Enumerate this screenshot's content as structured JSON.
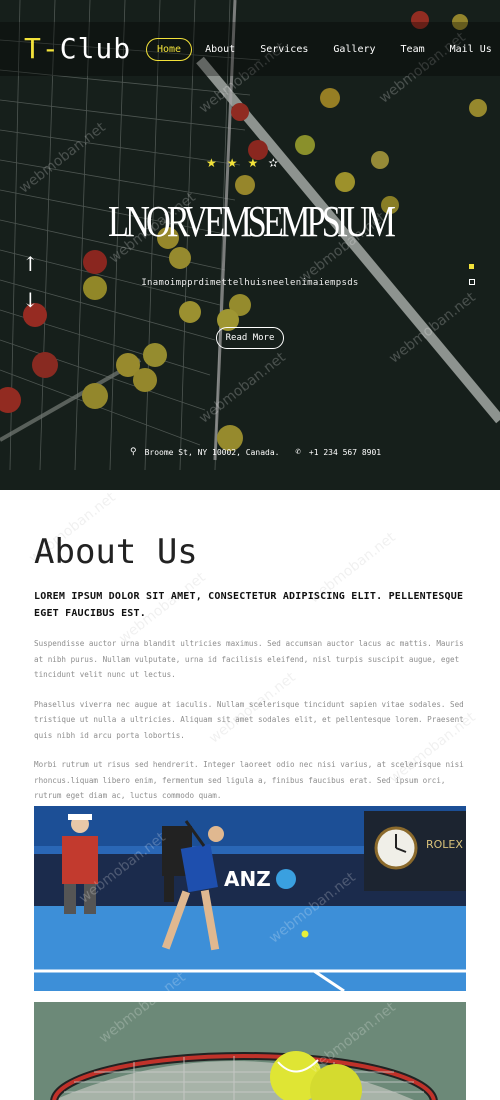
{
  "brand": {
    "logo_t": "T",
    "logo_dash": "-",
    "logo_rest": "Club"
  },
  "nav": {
    "items": [
      {
        "label": "Home",
        "active": true
      },
      {
        "label": "About",
        "active": false
      },
      {
        "label": "Services",
        "active": false
      },
      {
        "label": "Gallery",
        "active": false
      },
      {
        "label": "Team",
        "active": false
      },
      {
        "label": "Mail Us",
        "active": false
      }
    ]
  },
  "hero": {
    "title": "LNORVEMSEMPSIUM",
    "subtitle": "Inamoimpprdimettelhuisneelenimaiempsds",
    "read_more": "Read More",
    "rating_stars": 3.5
  },
  "contact": {
    "address": "Broome St, NY 10002, Canada.",
    "phone": "+1 234 567 8901"
  },
  "about": {
    "title": "About Us",
    "lead": "LOREM IPSUM DOLOR SIT AMET, CONSECTETUR ADIPISCING ELIT. PELLENTESQUE EGET FAUCIBUS EST.",
    "paragraphs": [
      "Suspendisse auctor urna blandit ultricies maximus. Sed accumsan auctor lacus ac mattis. Mauris at nibh purus. Nullam vulputate, urna id facilisis eleifend, nisl turpis suscipit augue, eget tincidunt velit nunc ut lectus.",
      "Phasellus viverra nec augue at iaculis. Nullam scelerisque tincidunt sapien vitae sodales. Sed tristique ut nulla a ultricies. Aliquam sit amet sodales elit, et pellentesque lorem. Praesent quis nibh id arcu porta lobortis.",
      "Morbi rutrum ut risus sed hendrerit. Integer laoreet odio nec nisi varius, at scelerisque nisi rhoncus.liquam libero enim, fermentum sed ligula a, finibus faucibus erat. Sed ipsum orci, rutrum eget diam ac, luctus commodo quam."
    ]
  },
  "court_image": {
    "sign_text": "ANZ",
    "rolex_text": "ROLEX"
  },
  "watermark": "webmoban.net",
  "colors": {
    "accent": "#f2e23a",
    "court": "#2e7fd0",
    "dark": "#1a2420"
  }
}
